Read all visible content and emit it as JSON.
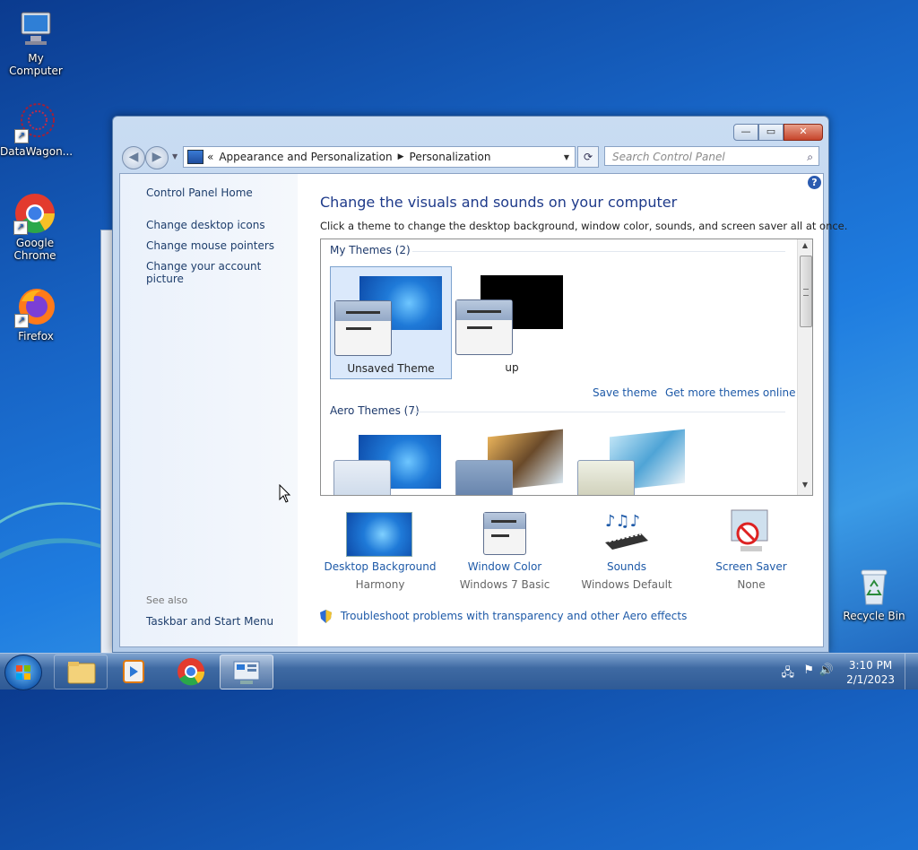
{
  "desktop": {
    "icons": [
      {
        "label": "My Computer"
      },
      {
        "label": "DataWagon..."
      },
      {
        "label": "Google Chrome"
      },
      {
        "label": "Firefox"
      },
      {
        "label": "Recycle Bin"
      }
    ]
  },
  "window": {
    "caption_buttons": {
      "minimize": "—",
      "maximize": "▭",
      "close": "✕"
    },
    "address": {
      "prefix": "«",
      "segments": [
        "Appearance and Personalization",
        "Personalization"
      ]
    },
    "search_placeholder": "Search Control Panel",
    "left_pane": {
      "home": "Control Panel Home",
      "links": [
        "Change desktop icons",
        "Change mouse pointers",
        "Change your account picture"
      ],
      "see_also_label": "See also",
      "see_also_links": [
        "Taskbar and Start Menu"
      ]
    },
    "main": {
      "title": "Change the visuals and sounds on your computer",
      "subtitle": "Click a theme to change the desktop background, window color, sounds, and screen saver all at once.",
      "my_themes_header": "My Themes (2)",
      "my_themes": [
        {
          "name": "Unsaved Theme",
          "selected": true,
          "background": "win7"
        },
        {
          "name": "up",
          "selected": false,
          "background": "black"
        }
      ],
      "save_theme": "Save theme",
      "get_more": "Get more themes online",
      "aero_header": "Aero Themes (7)",
      "settings": [
        {
          "name": "Desktop Background",
          "value": "Harmony",
          "icon": "desktop-background-icon"
        },
        {
          "name": "Window Color",
          "value": "Windows 7 Basic",
          "icon": "window-color-icon"
        },
        {
          "name": "Sounds",
          "value": "Windows Default",
          "icon": "sounds-icon"
        },
        {
          "name": "Screen Saver",
          "value": "None",
          "icon": "screen-saver-icon"
        }
      ],
      "troubleshoot": "Troubleshoot problems with transparency and other Aero effects"
    }
  },
  "taskbar": {
    "time": "3:10 PM",
    "date": "2/1/2023"
  },
  "colors": {
    "link": "#1e5aa8",
    "title": "#1e3a8a"
  }
}
